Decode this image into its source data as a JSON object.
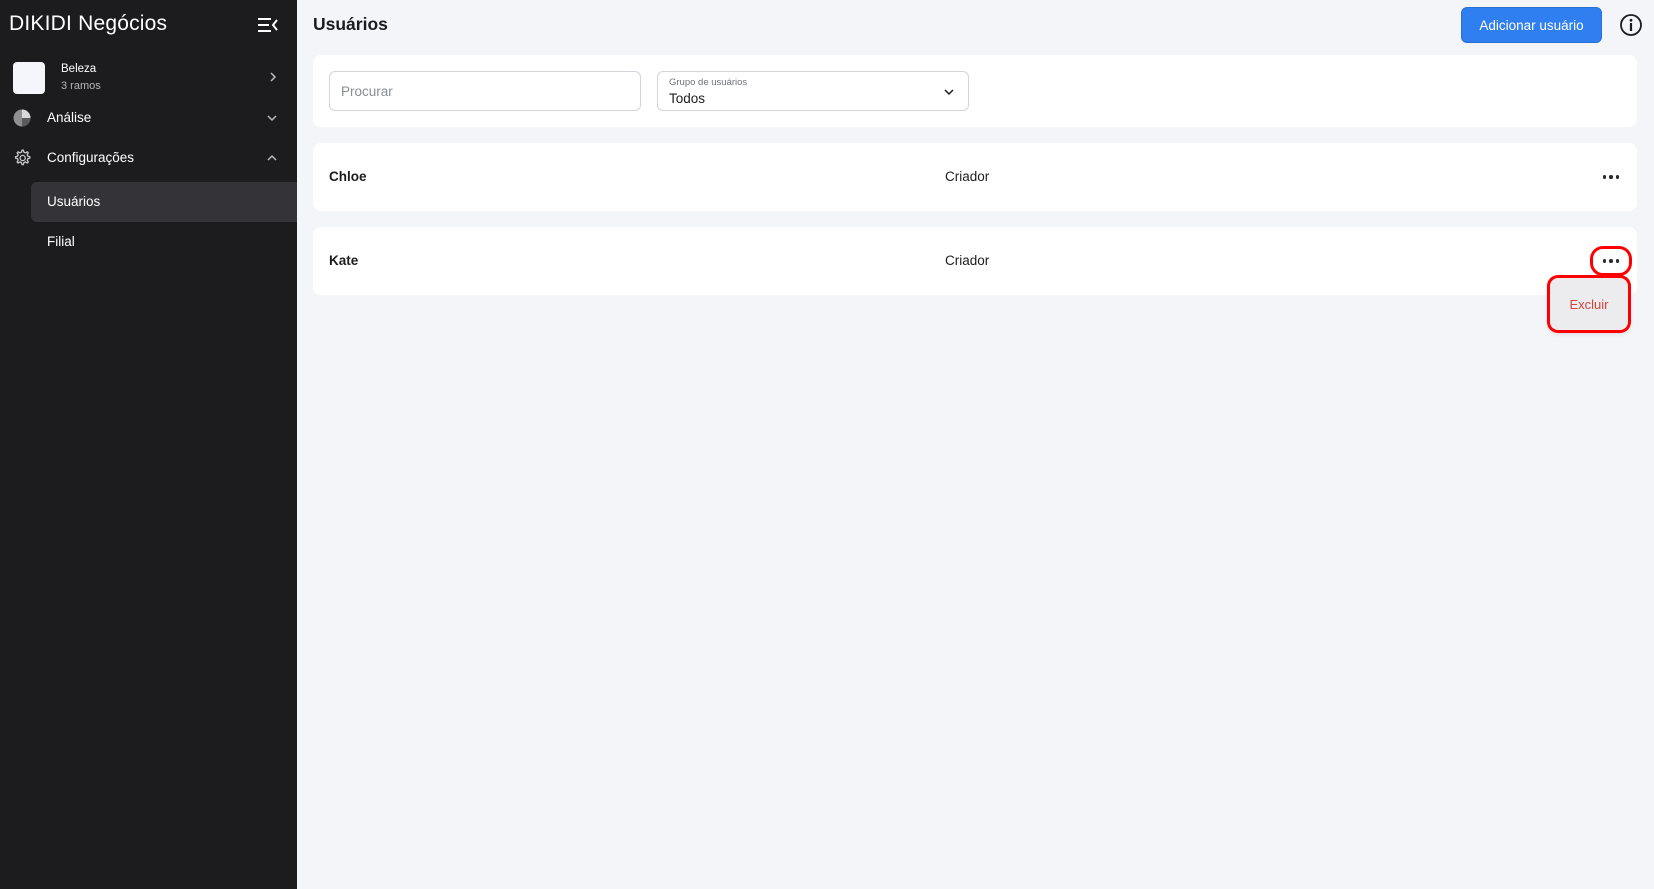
{
  "sidebar": {
    "app_title": "DIKIDI Negócios",
    "workspace": {
      "name": "Beleza",
      "subtitle": "3 ramos"
    },
    "nav": {
      "analysis_label": "Análise",
      "settings_label": "Configurações",
      "settings_items": [
        {
          "label": "Usuários",
          "active": true
        },
        {
          "label": "Filial",
          "active": false
        }
      ]
    }
  },
  "main": {
    "title": "Usuários",
    "add_button_label": "Adicionar usuário",
    "filters": {
      "search_placeholder": "Procurar",
      "search_value": "",
      "group_label": "Grupo de usuários",
      "group_value": "Todos"
    },
    "users": [
      {
        "name": "Chloe",
        "role": "Criador"
      },
      {
        "name": "Kate",
        "role": "Criador"
      }
    ],
    "row_menu": {
      "delete_label": "Excluir"
    }
  },
  "colors": {
    "sidebar_bg": "#1c1c1e",
    "accent": "#2f7ff0",
    "danger_text": "#d0453c",
    "highlight": "#ff0000",
    "page_bg": "#f4f5f9"
  }
}
